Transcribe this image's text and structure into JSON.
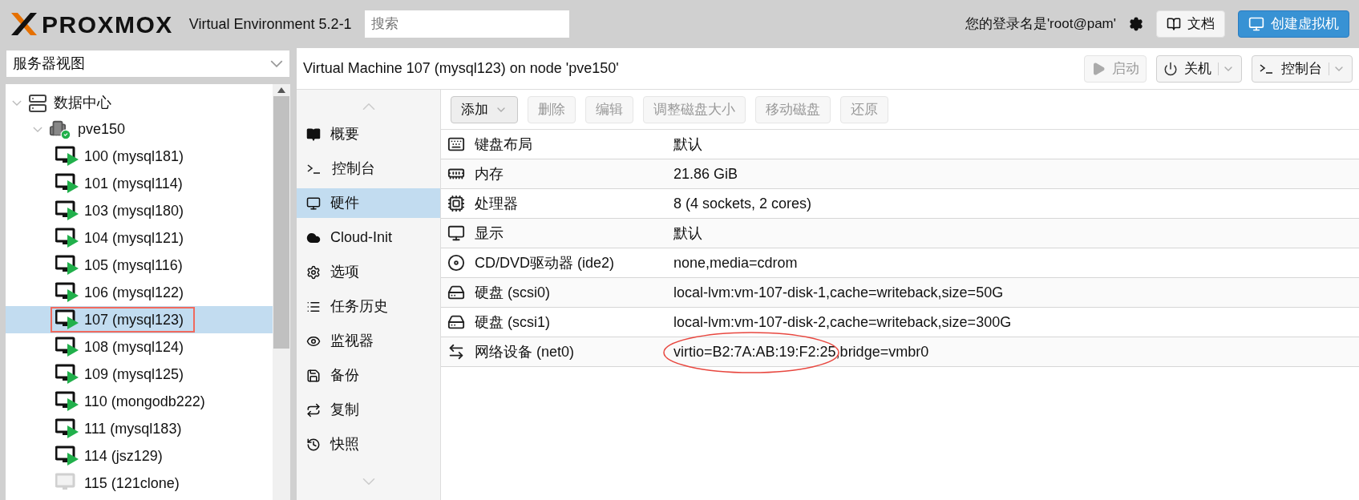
{
  "header": {
    "logo": "PROXMOX",
    "product": "Virtual Environment 5.2-1",
    "search": {
      "placeholder": "搜索"
    },
    "user": "您的登录名是'root@pam'",
    "buttons": [
      {
        "label": "文档",
        "primary": false
      },
      {
        "label": "创建虚拟机",
        "primary": true
      }
    ]
  },
  "sidebar": {
    "view_select": "服务器视图",
    "tree": [
      {
        "label": "数据中心",
        "expanded": true,
        "children": [
          {
            "label": "pve150",
            "expanded": true,
            "children": [
              {
                "label": "100 (mysql181)",
                "running": true,
                "selected": false,
                "highlighted": false
              },
              {
                "label": "101 (mysql114)",
                "running": true,
                "selected": false,
                "highlighted": false
              },
              {
                "label": "103 (mysql180)",
                "running": true,
                "selected": false,
                "highlighted": false
              },
              {
                "label": "104 (mysql121)",
                "running": true,
                "selected": false,
                "highlighted": false
              },
              {
                "label": "105 (mysql116)",
                "running": true,
                "selected": false,
                "highlighted": false
              },
              {
                "label": "106 (mysql122)",
                "running": true,
                "selected": false,
                "highlighted": false
              },
              {
                "label": "107 (mysql123)",
                "running": true,
                "selected": true,
                "highlighted": true
              },
              {
                "label": "108 (mysql124)",
                "running": true,
                "selected": false,
                "highlighted": false
              },
              {
                "label": "109 (mysql125)",
                "running": true,
                "selected": false,
                "highlighted": false
              },
              {
                "label": "110 (mongodb222)",
                "running": true,
                "selected": false,
                "highlighted": false
              },
              {
                "label": "111 (mysql183)",
                "running": true,
                "selected": false,
                "highlighted": false
              },
              {
                "label": "114 (jsz129)",
                "running": true,
                "selected": false,
                "highlighted": false
              },
              {
                "label": "115 (121clone)",
                "running": false,
                "selected": false,
                "highlighted": false
              }
            ]
          }
        ]
      }
    ]
  },
  "main": {
    "title": "Virtual Machine 107 (mysql123) on node 'pve150'",
    "actions": [
      {
        "label": "启动",
        "disabled": true,
        "split": false
      },
      {
        "label": "关机",
        "disabled": false,
        "split": true
      },
      {
        "label": "控制台",
        "disabled": false,
        "split": true
      }
    ],
    "nav": [
      {
        "label": "概要",
        "selected": false
      },
      {
        "label": "控制台",
        "selected": false
      },
      {
        "label": "硬件",
        "selected": true
      },
      {
        "label": "Cloud-Init",
        "selected": false
      },
      {
        "label": "选项",
        "selected": false
      },
      {
        "label": "任务历史",
        "selected": false
      },
      {
        "label": "监视器",
        "selected": false
      },
      {
        "label": "备份",
        "selected": false
      },
      {
        "label": "复制",
        "selected": false
      },
      {
        "label": "快照",
        "selected": false
      }
    ],
    "toolbar": [
      {
        "label": "添加",
        "disabled": false,
        "dropdown": true
      },
      {
        "label": "删除",
        "disabled": true,
        "dropdown": false
      },
      {
        "label": "编辑",
        "disabled": true,
        "dropdown": false
      },
      {
        "label": "调整磁盘大小",
        "disabled": true,
        "dropdown": false
      },
      {
        "label": "移动磁盘",
        "disabled": true,
        "dropdown": false
      },
      {
        "label": "还原",
        "disabled": true,
        "dropdown": false
      }
    ],
    "hardware": [
      {
        "name": "键盘布局",
        "value": "默认",
        "circled": false
      },
      {
        "name": "内存",
        "value": "21.86 GiB",
        "circled": false
      },
      {
        "name": "处理器",
        "value": "8 (4 sockets, 2 cores)",
        "circled": false
      },
      {
        "name": "显示",
        "value": "默认",
        "circled": false
      },
      {
        "name": "CD/DVD驱动器 (ide2)",
        "value": "none,media=cdrom",
        "circled": false
      },
      {
        "name": "硬盘 (scsi0)",
        "value": "local-lvm:vm-107-disk-1,cache=writeback,size=50G",
        "circled": false
      },
      {
        "name": "硬盘 (scsi1)",
        "value": "local-lvm:vm-107-disk-2,cache=writeback,size=300G",
        "circled": false
      },
      {
        "name": "网络设备 (net0)",
        "value": "virtio=B2:7A:AB:19:F2:25,bridge=vmbr0",
        "circled": true
      }
    ]
  }
}
